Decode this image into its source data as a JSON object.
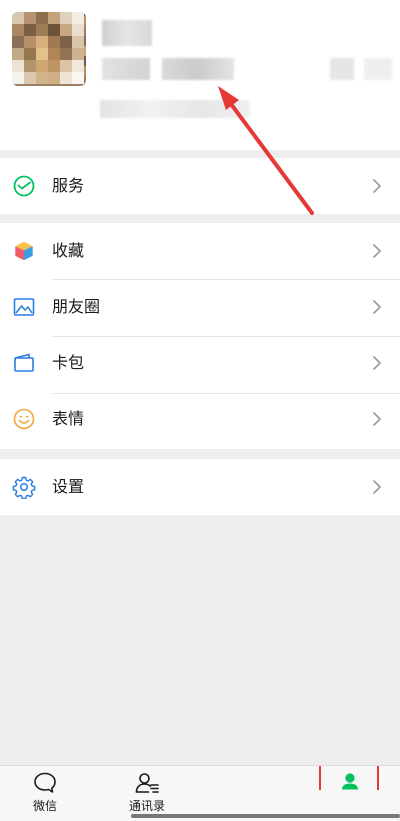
{
  "profile": {},
  "menu": {
    "services": {
      "label": "服务",
      "icon": "wechat-pay-icon"
    },
    "favorites": {
      "label": "收藏",
      "icon": "cube-icon"
    },
    "moments": {
      "label": "朋友圈",
      "icon": "image-icon"
    },
    "card_pack": {
      "label": "卡包",
      "icon": "wallet-icon"
    },
    "stickers": {
      "label": "表情",
      "icon": "smiley-icon"
    },
    "settings": {
      "label": "设置",
      "icon": "gear-icon"
    }
  },
  "tabbar": {
    "chats": {
      "label": "微信",
      "icon": "chat-bubble-icon"
    },
    "contacts": {
      "label": "通讯录",
      "icon": "contacts-icon"
    },
    "me": {
      "icon": "person-icon",
      "active": true
    }
  },
  "colors": {
    "accent_green": "#07c160",
    "annotation_red": "#e53935"
  }
}
